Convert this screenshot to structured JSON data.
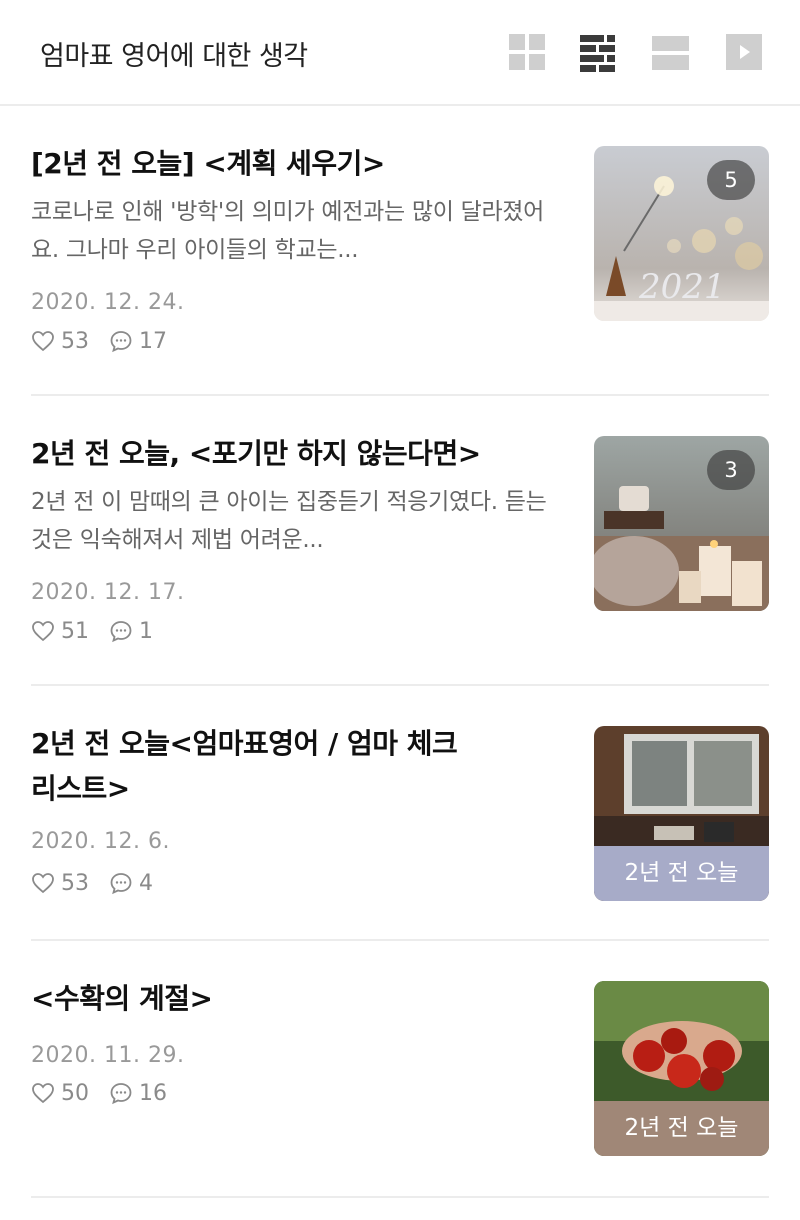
{
  "header": {
    "title": "엄마표 영어에 대한 생각",
    "views": [
      {
        "icon": "grid-view-icon"
      },
      {
        "icon": "list-view-icon"
      },
      {
        "icon": "card-view-icon"
      },
      {
        "icon": "play-view-icon"
      }
    ]
  },
  "posts": [
    {
      "title": "[2년 전 오늘] <계획 세우기>",
      "excerpt": "코로나로 인해 '방학'의 의미가 예전과는 많이 달라졌어요. 그나마 우리 아이들의 학교는...",
      "date": "2020. 12. 24.",
      "likes": "53",
      "comments": "17",
      "thumb_badge": "5",
      "thumb_label": ""
    },
    {
      "title": "2년 전 오늘, <포기만 하지 않는다면>",
      "excerpt": "2년 전 이 맘때의 큰 아이는 집중듣기 적응기였다. 듣는 것은 익숙해져서 제법 어려운...",
      "date": "2020. 12. 17.",
      "likes": "51",
      "comments": "1",
      "thumb_badge": "3",
      "thumb_label": ""
    },
    {
      "title": "2년 전 오늘<엄마표영어 /  엄마 체크리스트>",
      "excerpt": "",
      "date": "2020. 12. 6.",
      "likes": "53",
      "comments": "4",
      "thumb_badge": "",
      "thumb_label": "2년 전 오늘"
    },
    {
      "title": "<수확의 계절>",
      "excerpt": "",
      "date": "2020. 11. 29.",
      "likes": "50",
      "comments": "16",
      "thumb_badge": "",
      "thumb_label": "2년 전 오늘"
    }
  ],
  "colors": {
    "list_icon_active": "#3b3b3b",
    "icon_inactive": "#cfcfcf",
    "label_bg_post3": "#a7abc8",
    "label_bg_post4": "#a08777"
  }
}
